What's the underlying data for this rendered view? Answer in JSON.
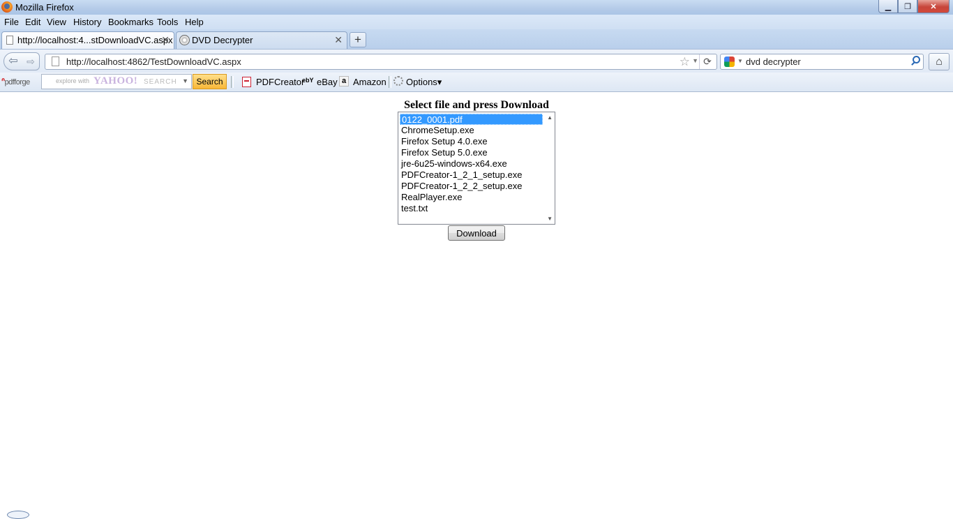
{
  "window": {
    "title": "Mozilla Firefox",
    "minimize": "▁",
    "maximize": "❐",
    "close": "✕"
  },
  "menu": [
    "File",
    "Edit",
    "View",
    "History",
    "Bookmarks",
    "Tools",
    "Help"
  ],
  "tabs": [
    {
      "label": "http://localhost:4...stDownloadVC.aspx",
      "active": true
    },
    {
      "label": "DVD Decrypter",
      "active": false
    }
  ],
  "new_tab_label": "+",
  "nav": {
    "back": "⇦",
    "forward": "⇨",
    "url": "http://localhost:4862/TestDownloadVC.aspx",
    "search_value": "dvd decrypter",
    "home": "⌂",
    "star": "☆",
    "reload": "⟳"
  },
  "toolbar": {
    "brand_mark": "ᐢ",
    "brand": "pdfforge",
    "yahoo_hint": "explore with",
    "yahoo_brand": "YAHOO!",
    "yahoo_search_hint": "SEARCH",
    "search_button": "Search",
    "items": {
      "pdfcreator": "PDFCreator",
      "ebay": "eBay",
      "ebay_logo": "ebY",
      "amazon": "Amazon",
      "amazon_logo": "a",
      "options": "Options▾"
    }
  },
  "content": {
    "title": "Select file and press Download",
    "files": [
      "0122_0001.pdf",
      "ChromeSetup.exe",
      "Firefox Setup 4.0.exe",
      "Firefox Setup 5.0.exe",
      "jre-6u25-windows-x64.exe",
      "PDFCreator-1_2_1_setup.exe",
      "PDFCreator-1_2_2_setup.exe",
      "RealPlayer.exe",
      "test.txt"
    ],
    "selected_file": "0122_0001.pdf",
    "download_button": "Download"
  },
  "colors": {
    "selection": "#3399ff",
    "chrome": "#dbe8f8"
  }
}
